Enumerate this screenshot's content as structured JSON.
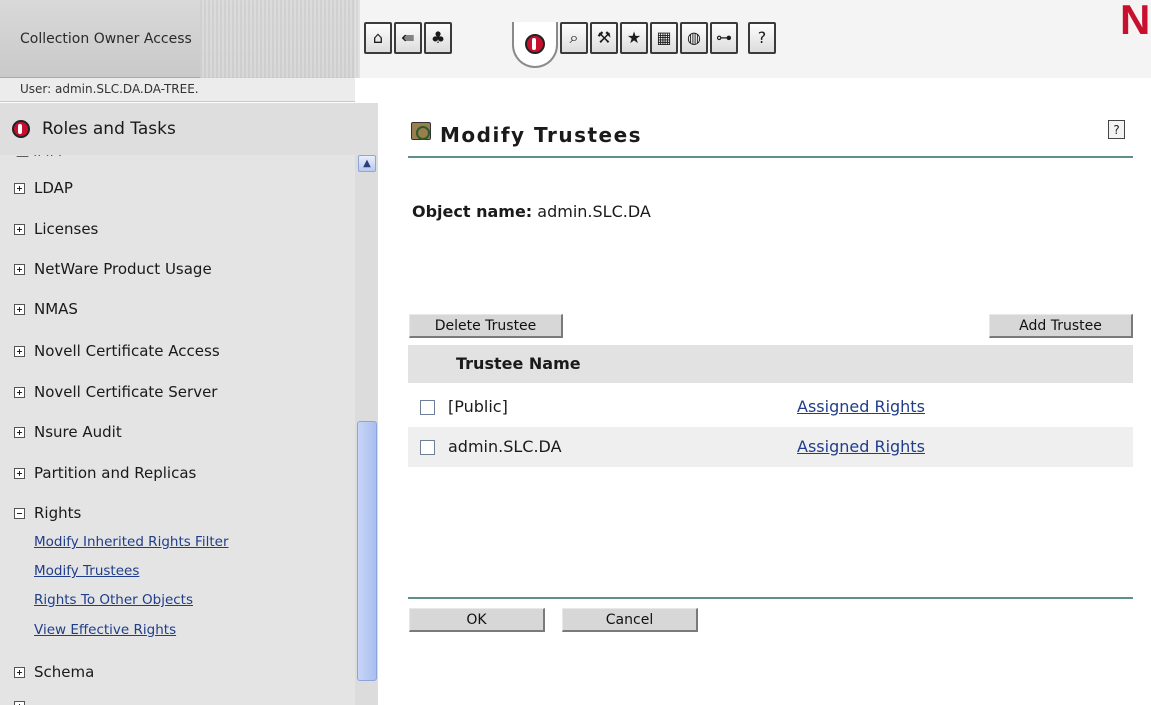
{
  "app": {
    "title": "Collection Owner Access",
    "user_label": "User: admin.SLC.DA.DA-TREE."
  },
  "toolbar": {
    "buttons": [
      "home-icon",
      "exit-icon",
      "tree-icon",
      "roles-icon",
      "search-icon",
      "create-icon",
      "favorites-icon",
      "objects-icon",
      "configure-icon",
      "connections-icon",
      "help-book-icon"
    ]
  },
  "sidebar": {
    "title": "Roles and Tasks",
    "categories": [
      {
        "label": "LDAP"
      },
      {
        "label": "Licenses"
      },
      {
        "label": "NetWare Product Usage"
      },
      {
        "label": "NMAS"
      },
      {
        "label": "Novell Certificate Access"
      },
      {
        "label": "Novell Certificate Server"
      },
      {
        "label": "Nsure Audit"
      },
      {
        "label": "Partition and Replicas"
      },
      {
        "label": "Rights"
      },
      {
        "label": "Schema"
      }
    ],
    "rights_tasks": [
      "Modify Inherited Rights Filter",
      "Modify Trustees",
      "Rights To Other Objects",
      "View Effective Rights"
    ]
  },
  "main": {
    "title": "Modify Trustees",
    "object_label": "Object name:",
    "object_value": "admin.SLC.DA",
    "delete_button": "Delete Trustee",
    "add_button": "Add Trustee",
    "column_header": "Trustee Name",
    "rows": [
      {
        "name": "[Public]",
        "link": "Assigned Rights"
      },
      {
        "name": "admin.SLC.DA",
        "link": "Assigned Rights"
      }
    ],
    "ok_button": "OK",
    "cancel_button": "Cancel"
  },
  "colors": {
    "accent_red": "#c8102e",
    "rule_teal": "#5f8f8b",
    "link_blue": "#1f3d8a"
  }
}
